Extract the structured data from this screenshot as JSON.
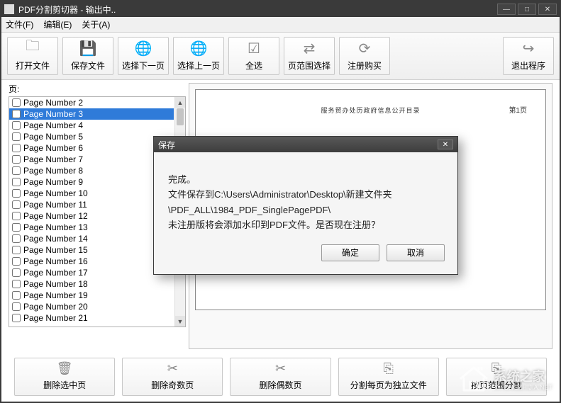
{
  "window": {
    "title": "PDF分割剪切器 - 输出中.."
  },
  "menu": {
    "file": "文件(F)",
    "edit": "编辑(E)",
    "about": "关于(A)"
  },
  "toolbar": {
    "open": "打开文件",
    "save": "保存文件",
    "select_next": "选择下一页",
    "select_prev": "选择上一页",
    "select_all": "全选",
    "page_range": "页范围选择",
    "register": "注册购买",
    "exit": "退出程序"
  },
  "pages_label": "页:",
  "page_list": [
    {
      "label": "Page Number 2",
      "selected": false
    },
    {
      "label": "Page Number 3",
      "selected": true
    },
    {
      "label": "Page Number 4",
      "selected": false
    },
    {
      "label": "Page Number 5",
      "selected": false
    },
    {
      "label": "Page Number 6",
      "selected": false
    },
    {
      "label": "Page Number 7",
      "selected": false
    },
    {
      "label": "Page Number 8",
      "selected": false
    },
    {
      "label": "Page Number 9",
      "selected": false
    },
    {
      "label": "Page Number 10",
      "selected": false
    },
    {
      "label": "Page Number 11",
      "selected": false
    },
    {
      "label": "Page Number 12",
      "selected": false
    },
    {
      "label": "Page Number 13",
      "selected": false
    },
    {
      "label": "Page Number 14",
      "selected": false
    },
    {
      "label": "Page Number 15",
      "selected": false
    },
    {
      "label": "Page Number 16",
      "selected": false
    },
    {
      "label": "Page Number 17",
      "selected": false
    },
    {
      "label": "Page Number 18",
      "selected": false
    },
    {
      "label": "Page Number 19",
      "selected": false
    },
    {
      "label": "Page Number 20",
      "selected": false
    },
    {
      "label": "Page Number 21",
      "selected": false
    }
  ],
  "preview": {
    "header_text": "服务贸办处历政府信息公开目录",
    "page_indicator": "第1页"
  },
  "bottom": {
    "delete_selected": "删除选中页",
    "delete_odd": "删除奇数页",
    "delete_even": "删除偶数页",
    "split_each": "分割每页为独立文件",
    "restore_from_delete": "按页范围分割"
  },
  "dialog": {
    "title": "保存",
    "line1": "完成。",
    "line2": "文件保存到C:\\Users\\Administrator\\Desktop\\新建文件夹",
    "line3": "\\PDF_ALL\\1984_PDF_SinglePagePDF\\",
    "line4": "未注册版将会添加水印到PDF文件。是否现在注册？",
    "ok": "确定",
    "cancel": "取消"
  },
  "watermark": {
    "text": "系统之家",
    "url": "XITONGZHIJIA.NET"
  }
}
